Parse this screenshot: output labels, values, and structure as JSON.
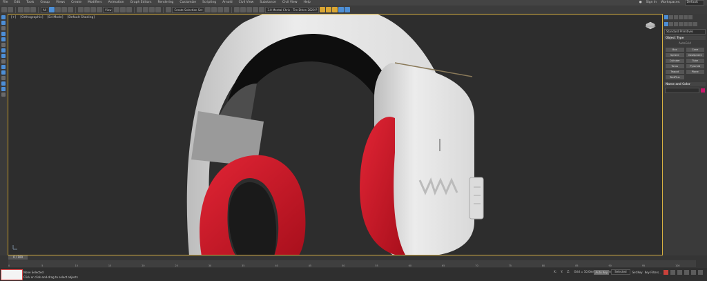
{
  "menu": {
    "items": [
      "File",
      "Edit",
      "Tools",
      "Group",
      "Views",
      "Create",
      "Modifiers",
      "Animation",
      "Graph Editors",
      "Rendering",
      "Customize",
      "Scripting",
      "Arnold",
      "Civil View",
      "Substance",
      "Civil View",
      "Help"
    ],
    "sign_in": "Sign In",
    "workspaces_label": "Workspaces:",
    "workspace_value": "Default"
  },
  "toolbar": {
    "view_dropdown": "View",
    "selection_set_dropdown": "Create Selection Set",
    "frame_dropdown": "3.0 Mental Chris - Tim Ethen 2020 P"
  },
  "viewport": {
    "label_plus": "+",
    "label_view": "Orthographic",
    "label_edge": "Ed Mode",
    "label_shading": "Default Shading"
  },
  "command_panel": {
    "category_dropdown": "Standard Primitives",
    "object_type_title": "Object Type",
    "autogrid": "AutoGrid",
    "object_buttons": [
      "Box",
      "Cone",
      "Sphere",
      "GeoSphere",
      "Cylinder",
      "Tube",
      "Torus",
      "Pyramid",
      "Teapot",
      "Plane",
      "TextPlus"
    ],
    "name_color_title": "Name and Color",
    "swatch_color": "#c8186a"
  },
  "timeline": {
    "slider_label": "0 / 100",
    "ticks": [
      "0",
      "5",
      "10",
      "15",
      "20",
      "25",
      "30",
      "35",
      "40",
      "45",
      "50",
      "55",
      "60",
      "65",
      "70",
      "75",
      "80",
      "85",
      "90",
      "95",
      "100"
    ]
  },
  "status": {
    "selection": "None Selected",
    "prompt": "Click or click-and-drag to select objects",
    "coord_x": "X:",
    "coord_y": "Y:",
    "coord_z": "Z:",
    "grid": "Grid = 10,0mm",
    "add_time_tag": "Add Time Tag",
    "auto_key": "Auto Key",
    "selected_dropdown": "Selected",
    "set_key": "Set Key",
    "key_filters": "Key Filters..."
  },
  "colors": {
    "viewport_border": "#d7b042",
    "earcup_red": "#d51a2a",
    "shell_white": "#eaeaea",
    "toolbar_blue": "#4d8fd6"
  }
}
